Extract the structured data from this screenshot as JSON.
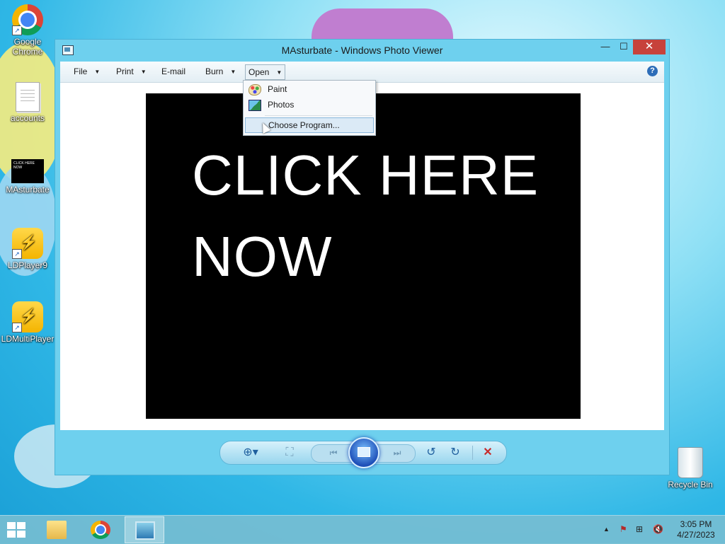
{
  "desktop": {
    "icons": [
      {
        "label": "Google Chrome",
        "icon": "chrome-icon"
      },
      {
        "label": "accounts",
        "icon": "text-file-icon"
      },
      {
        "label": "MAsturbate",
        "icon": "image-file-icon",
        "thumb_text": "CLICK HERE NOW"
      },
      {
        "label": "LDPlayer9",
        "icon": "ldplayer-icon"
      },
      {
        "label": "LDMultiPlayer",
        "icon": "ldmultiplayer-icon"
      },
      {
        "label": "Recycle Bin",
        "icon": "recycle-bin-icon"
      }
    ]
  },
  "window": {
    "title": "MAsturbate - Windows Photo Viewer",
    "controls": {
      "minimize": "—",
      "maximize": "☐",
      "close": "✕"
    },
    "toolbar": {
      "file": "File",
      "print": "Print",
      "email": "E-mail",
      "burn": "Burn",
      "open": "Open",
      "help": "?"
    },
    "open_menu": {
      "items": [
        "Paint",
        "Photos",
        "Choose Program..."
      ],
      "highlighted": "Choose Program..."
    },
    "image_text": {
      "line1": "CLICK HERE",
      "line2": "NOW"
    },
    "playback": {
      "zoom": "⊕▾",
      "fit": "⛶",
      "previous": "⏮",
      "next": "⏭",
      "rotate_left": "↺",
      "rotate_right": "↻",
      "delete": "✕"
    }
  },
  "taskbar": {
    "clock_time": "3:05 PM",
    "clock_date": "4/27/2023",
    "tray_up": "▲",
    "tray_flag": "⚑",
    "tray_network": "⊞",
    "tray_volume": "🔇"
  }
}
